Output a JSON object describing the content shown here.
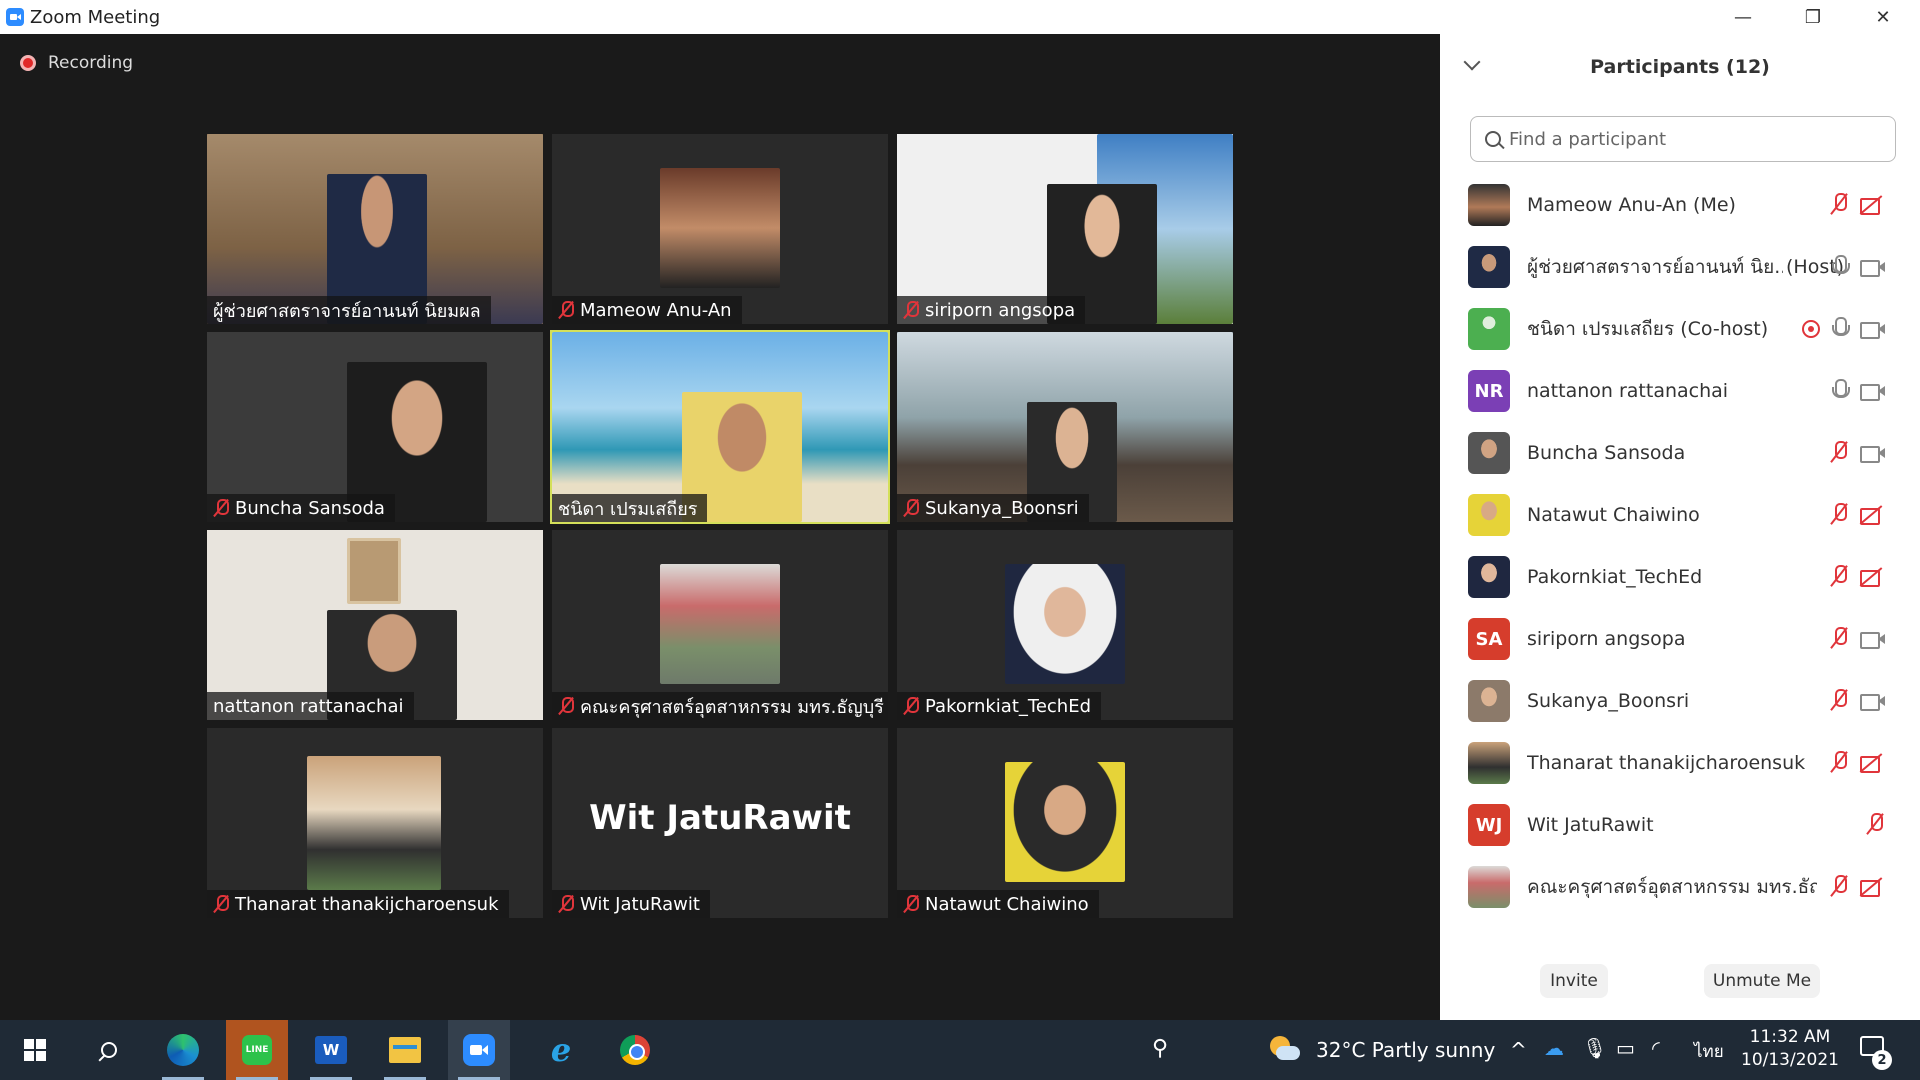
{
  "window": {
    "title": "Zoom Meeting",
    "min_glyph": "—",
    "max_glyph": "❐",
    "close_glyph": "✕"
  },
  "meeting": {
    "recording_label": "Recording"
  },
  "tiles": [
    {
      "name": "ผู้ช่วยศาสตราจารย์อานนท์ นิยมผล",
      "muted": false
    },
    {
      "name": "Mameow Anu-An",
      "muted": true
    },
    {
      "name": "siriporn angsopa",
      "muted": true
    },
    {
      "name": "Buncha Sansoda",
      "muted": true
    },
    {
      "name": "ชนิดา เปรมเสถียร",
      "muted": false,
      "active_speaker": true
    },
    {
      "name": "Sukanya_Boonsri",
      "muted": true
    },
    {
      "name": "nattanon rattanachai",
      "muted": false
    },
    {
      "name": "คณะครุศาสตร์อุตสาหกรรม มทร.ธัญบุรี",
      "muted": true
    },
    {
      "name": "Pakornkiat_TechEd",
      "muted": true
    },
    {
      "name": "Thanarat thanakijcharoensuk",
      "muted": true
    },
    {
      "name": "Wit JatuRawit",
      "muted": true,
      "big_label": "Wit JatuRawit"
    },
    {
      "name": "Natawut Chaiwino",
      "muted": true
    }
  ],
  "panel": {
    "title": "Participants (12)",
    "search_placeholder": "Find a participant",
    "participants": [
      {
        "name": "Mameow Anu-An (Me)",
        "role": "",
        "mic": "off",
        "cam": "off",
        "avatar_color": "#3a3a3a"
      },
      {
        "name": "ผู้ช่วยศาสตราจารย์อานนท์ นิย...",
        "role": "(Host)",
        "mic": "on",
        "cam": "on",
        "avatar_color": "#6b5a4d"
      },
      {
        "name": "ชนิดา เปรมเสถียร (Co-host)",
        "role": "",
        "mic": "on",
        "cam": "on",
        "rec": true,
        "avatar_color": "#4caf50"
      },
      {
        "name": "nattanon rattanachai",
        "role": "",
        "mic": "on",
        "cam": "on",
        "initials": "NR",
        "avatar_color": "#7b3fb5"
      },
      {
        "name": "Buncha Sansoda",
        "role": "",
        "mic": "off",
        "cam": "on",
        "avatar_color": "#9a8f86"
      },
      {
        "name": "Natawut Chaiwino",
        "role": "",
        "mic": "off",
        "cam": "off",
        "avatar_color": "#7c8a6d"
      },
      {
        "name": "Pakornkiat_TechEd",
        "role": "",
        "mic": "off",
        "cam": "off",
        "avatar_color": "#5a5f6a"
      },
      {
        "name": "siriporn angsopa",
        "role": "",
        "mic": "off",
        "cam": "on",
        "initials": "SA",
        "avatar_color": "#d63d2c"
      },
      {
        "name": "Sukanya_Boonsri",
        "role": "",
        "mic": "off",
        "cam": "on",
        "avatar_color": "#8c7a6a"
      },
      {
        "name": "Thanarat thanakijcharoensuk",
        "role": "",
        "mic": "off",
        "cam": "off",
        "avatar_color": "#6d5a46"
      },
      {
        "name": "Wit JatuRawit",
        "role": "",
        "mic": "off",
        "cam": "none",
        "initials": "WJ",
        "avatar_color": "#d63d2c"
      },
      {
        "name": "คณะครุศาสตร์อุตสาหกรรม มทร.ธัญบุรี",
        "role": "",
        "mic": "off",
        "cam": "off",
        "avatar_color": "#9c7b6a"
      }
    ],
    "invite_label": "Invite",
    "unmute_label": "Unmute Me"
  },
  "taskbar": {
    "line_label": "LINE",
    "word_label": "W",
    "ie_label": "e",
    "weather": "32°C  Partly sunny",
    "tray_chevron": "^",
    "language": "ไทย",
    "time": "11:32 AM",
    "date": "10/13/2021",
    "notification_count": "2"
  }
}
